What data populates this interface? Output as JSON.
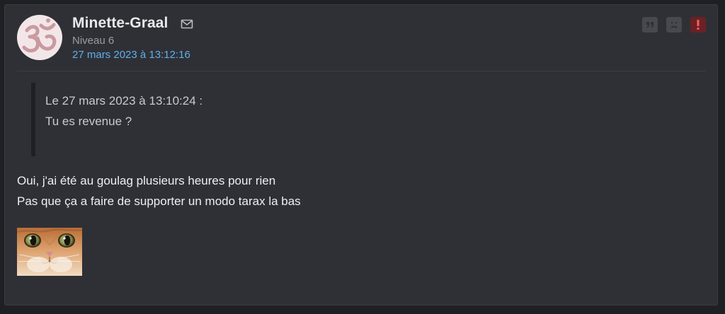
{
  "post": {
    "author": {
      "name": "Minette-Graal",
      "level": "Niveau 6",
      "avatar_icon": "om-symbol-icon",
      "avatar_color": "#c99aa0"
    },
    "date": "27 mars 2023 à 13:12:16",
    "actions": [
      {
        "name": "quote-button",
        "icon": "quote-icon"
      },
      {
        "name": "sad-face-button",
        "icon": "sad-face-icon"
      },
      {
        "name": "report-button",
        "icon": "exclamation-icon",
        "color": "#c0392b"
      }
    ],
    "quote": {
      "header": "Le 27 mars 2023 à 13:10:24 :",
      "text": "Tu es revenue ?"
    },
    "message": {
      "line1": "Oui, j'ai été au goulag plusieurs heures pour rien",
      "line2": "Pas que ça a faire de supporter un modo tarax la bas"
    },
    "sticker_icon": "cat-face-sticker"
  },
  "colors": {
    "background": "#1f2024",
    "card": "#2f3036",
    "link": "#5fb0ea",
    "text": "#eeeff1",
    "muted": "#9a9ca3"
  }
}
